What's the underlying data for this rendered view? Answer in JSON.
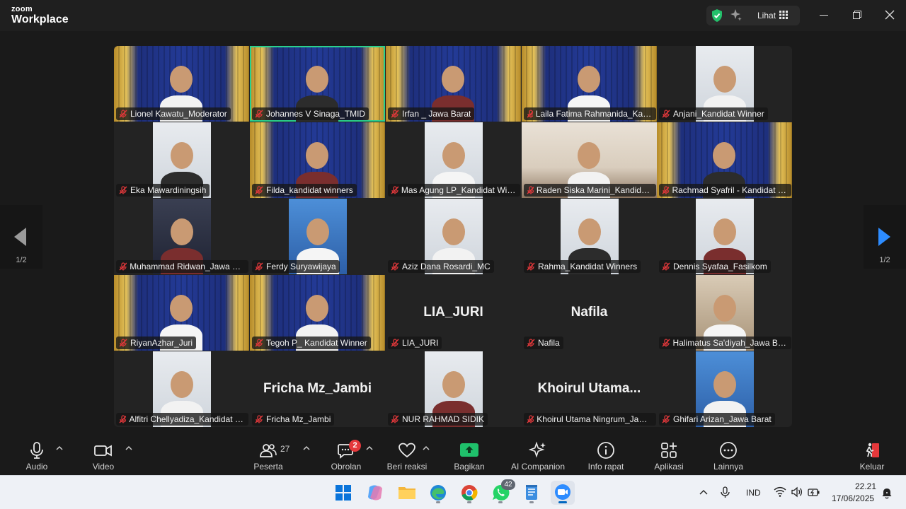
{
  "window": {
    "brand_top": "zoom",
    "brand_bottom": "Workplace",
    "view_label": "Lihat"
  },
  "gallery": {
    "page_left": "1/2",
    "page_right": "1/2",
    "tiles": [
      {
        "name": "Lionel Kawatu_Moderator",
        "bg": "stage"
      },
      {
        "name": "Johannes V Sinaga_TMID",
        "bg": "stage",
        "active": true
      },
      {
        "name": "Irfan _ Jawa Barat",
        "bg": "stage"
      },
      {
        "name": "Laila Fatima Rahmanida_Kandidat Winner",
        "bg": "stage"
      },
      {
        "name": "Anjani_Kandidat Winner",
        "bg": "portrait-light"
      },
      {
        "name": "Eka Mawardiningsih",
        "bg": "portrait-light"
      },
      {
        "name": "Filda_kandidat winners",
        "bg": "stage"
      },
      {
        "name": "Mas Agung LP_Kandidat Winners",
        "bg": "portrait-light"
      },
      {
        "name": "Raden Siska Marini_Kandidat Winner",
        "bg": "room"
      },
      {
        "name": "Rachmad Syafril - Kandidat Winner",
        "bg": "stage"
      },
      {
        "name": "Muhammad Ridwan_Jawa Barat",
        "bg": "portrait-dark"
      },
      {
        "name": "Ferdy Suryawijaya",
        "bg": "portrait-blue"
      },
      {
        "name": "Aziz Dana Rosardi_MC",
        "bg": "portrait-light"
      },
      {
        "name": "Rahma_Kandidat Winners",
        "bg": "portrait-light"
      },
      {
        "name": "Dennis Syafaa_Fasilkom",
        "bg": "portrait-light"
      },
      {
        "name": "RiyanAzhar_Juri",
        "bg": "stage"
      },
      {
        "name": "Tegoh P_ Kandidat Winner",
        "bg": "stage"
      },
      {
        "name": "LIA_JURI",
        "bg": "none",
        "display": "LIA_JURI"
      },
      {
        "name": "Nafila",
        "bg": "none",
        "display": "Nafila"
      },
      {
        "name": "Halimatus Sa'diyah_Jawa Barat",
        "bg": "portrait-warm"
      },
      {
        "name": "Alfitri Chellyadiza_Kandidat Winner",
        "bg": "portrait-light"
      },
      {
        "name": "Fricha Mz_Jambi",
        "bg": "none",
        "display": "Fricha Mz_Jambi"
      },
      {
        "name": "NUR RAHMAD SIDIK",
        "bg": "portrait-light"
      },
      {
        "name": "Khoirul Utama Ningrum_Jawa Barat",
        "bg": "none",
        "display": "Khoirul  Utama..."
      },
      {
        "name": "Ghifari Arizan_Jawa Barat",
        "bg": "portrait-blue"
      }
    ]
  },
  "toolbar": {
    "audio": "Audio",
    "video": "Video",
    "participants": "Peserta",
    "participants_count": "27",
    "chat": "Obrolan",
    "chat_badge": "2",
    "reactions": "Beri reaksi",
    "share": "Bagikan",
    "ai": "AI Companion",
    "info": "Info rapat",
    "apps": "Aplikasi",
    "more": "Lainnya",
    "leave": "Keluar"
  },
  "taskbar": {
    "whatsapp_badge": "42",
    "language": "IND",
    "time": "22.21",
    "date": "17/06/2025"
  },
  "colors": {
    "active_speaker": "#2ad08e",
    "muted": "#e5383b",
    "share_green": "#1fc16b",
    "leave_red": "#e5383b"
  }
}
